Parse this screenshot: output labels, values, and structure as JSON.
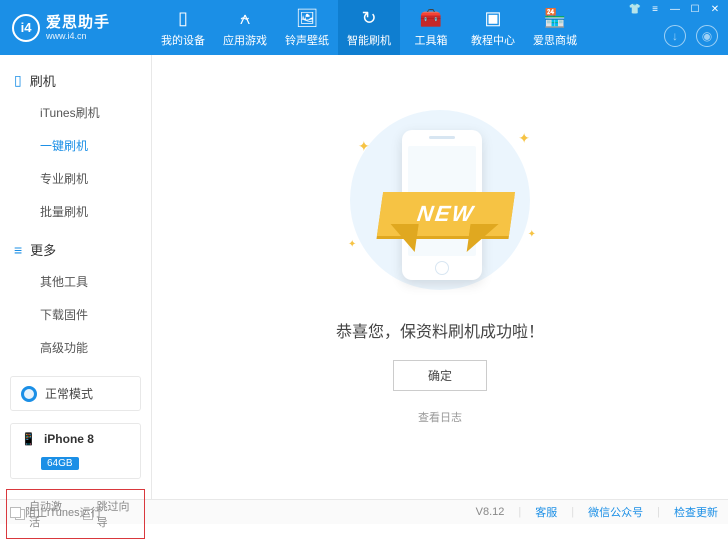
{
  "app": {
    "name": "爱思助手",
    "url": "www.i4.cn",
    "logo_letters": "i4"
  },
  "nav": [
    {
      "id": "devices",
      "label": "我的设备",
      "icon": "▯"
    },
    {
      "id": "apps",
      "label": "应用游戏",
      "icon": "⍲"
    },
    {
      "id": "ring",
      "label": "铃声壁纸",
      "icon": "🖼"
    },
    {
      "id": "flash",
      "label": "智能刷机",
      "icon": "↻",
      "active": true
    },
    {
      "id": "tools",
      "label": "工具箱",
      "icon": "🧰"
    },
    {
      "id": "tutorial",
      "label": "教程中心",
      "icon": "▣"
    },
    {
      "id": "store",
      "label": "爱思商城",
      "icon": "🏪"
    }
  ],
  "sidebar": {
    "sections": [
      {
        "id": "flash",
        "title": "刷机",
        "icon": "▯",
        "items": [
          {
            "id": "itunes",
            "label": "iTunes刷机"
          },
          {
            "id": "onekey",
            "label": "一键刷机",
            "active": true
          },
          {
            "id": "pro",
            "label": "专业刷机"
          },
          {
            "id": "batch",
            "label": "批量刷机"
          }
        ]
      },
      {
        "id": "more",
        "title": "更多",
        "icon": "≡",
        "items": [
          {
            "id": "othertools",
            "label": "其他工具"
          },
          {
            "id": "download",
            "label": "下载固件"
          },
          {
            "id": "advanced",
            "label": "高级功能"
          }
        ]
      }
    ]
  },
  "mode": {
    "label": "正常模式"
  },
  "device": {
    "name": "iPhone 8",
    "storage": "64GB"
  },
  "options": {
    "auto_activate": "自动激活",
    "skip_guide": "跳过向导"
  },
  "content": {
    "banner": "NEW",
    "message": "恭喜您，保资料刷机成功啦！",
    "ok": "确定",
    "view_log": "查看日志"
  },
  "footer": {
    "block_itunes": "阻止iTunes运行",
    "version": "V8.12",
    "links": {
      "support": "客服",
      "wechat": "微信公众号",
      "update": "检查更新"
    }
  }
}
